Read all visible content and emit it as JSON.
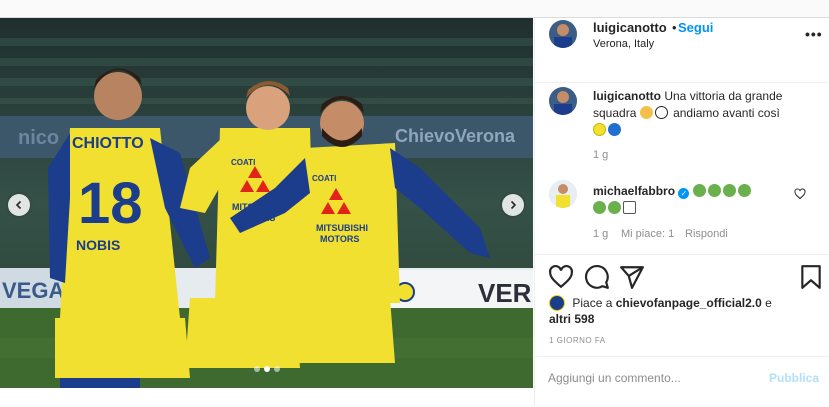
{
  "post": {
    "author": "luigicanotto",
    "separator": "•",
    "follow_label": "Segui",
    "location": "Verona, Italy",
    "more_label": "•••",
    "photo_icons": [
      "chevron-left-icon",
      "chevron-right-icon"
    ],
    "photo_text": {
      "jersey_name": "CHIOTTO",
      "jersey_number": "18",
      "sponsor_1": "MITSUBISHI",
      "sponsor_2": "MOTORS",
      "sponsor_3": "NOBIS",
      "sponsor_4": "COATI",
      "stadium_banner": "ChievoVerona",
      "board_text": "VER",
      "board_text_2": "VEGA"
    }
  },
  "caption": {
    "user": "luigicanotto",
    "text": "Una vittoria da grande squadra",
    "text_after": "andiamo avanti così",
    "time": "1 g"
  },
  "comment": {
    "user": "michaelfabbro",
    "verified_icon": "verified-badge-icon",
    "time": "1 g",
    "likes": "Mi piace: 1",
    "reply": "Rispondi",
    "like_icon": "heart-outline-icon"
  },
  "actions": {
    "icons": [
      "heart-icon",
      "comment-icon",
      "share-icon",
      "bookmark-icon"
    ]
  },
  "likes": {
    "prefix": "Piace a",
    "user": "chievofanpage_official2.0",
    "suffix": "e",
    "others": "altri 598"
  },
  "timestamp": "1 GIORNO FA",
  "composer": {
    "placeholder": "Aggiungi un commento...",
    "publish_label": "Pubblica"
  },
  "colors": {
    "accent": "#0095f6",
    "publish_disabled": "#b2dffc",
    "jersey_yellow": "#f2e030",
    "jersey_blue": "#1b3d8c"
  }
}
